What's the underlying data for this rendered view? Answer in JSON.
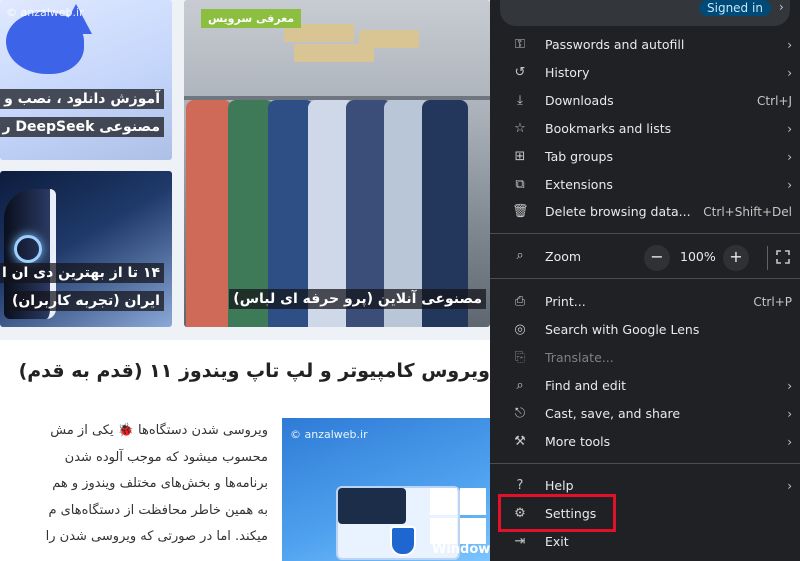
{
  "page": {
    "watermark": "© anzalweb.ir",
    "cards": [
      {
        "title_line1": "آموزش دانلود ، نصب و",
        "title_line2": "مصنوعی DeepSeek ر"
      },
      {
        "title_line1": "۱۴ تا از بهترین دی ان ا",
        "title_line2": "ایران (تجربه کاربران)"
      },
      {
        "tag": "معرفی سرویس",
        "title": "مصنوعی آنلاین (پرو حرفه ای لباس)"
      }
    ],
    "headline": "ویروس کامپیوتر و لپ تاپ ویندوز ۱۱ (قدم به قدم)",
    "paragraph_lines": [
      "ویروسی شدن دستگاه‌ها 🐞 یکی از مش",
      "محسوب میشود که موجب آلوده شدن",
      "برنامه‌ها و بخش‌های مختلف ویندوز و هم",
      "به همین خاطر محافظت از دستگاه‌های م",
      "میکند. اما در صورتی که ویروسی شدن را"
    ],
    "image_watermark": "© anzalweb.ir",
    "image_text": "Window"
  },
  "menu": {
    "signed_in": "Signed in",
    "items": [
      {
        "label": "Passwords and autofill",
        "icon": "key-icon",
        "glyph": "⚿",
        "right": "›"
      },
      {
        "label": "History",
        "icon": "history-icon",
        "glyph": "↺",
        "right": "›"
      },
      {
        "label": "Downloads",
        "icon": "download-icon",
        "glyph": "⤓",
        "right": "Ctrl+J"
      },
      {
        "label": "Bookmarks and lists",
        "icon": "star-icon",
        "glyph": "☆",
        "right": "›"
      },
      {
        "label": "Tab groups",
        "icon": "tab-groups-icon",
        "glyph": "⊞",
        "right": "›"
      },
      {
        "label": "Extensions",
        "icon": "extension-icon",
        "glyph": "⧉",
        "right": "›"
      },
      {
        "label": "Delete browsing data...",
        "icon": "trash-icon",
        "glyph": "🗑",
        "right": "Ctrl+Shift+Del"
      },
      {
        "label": "Print...",
        "icon": "print-icon",
        "glyph": "⎙",
        "right": "Ctrl+P"
      },
      {
        "label": "Search with Google Lens",
        "icon": "lens-icon",
        "glyph": "◎",
        "right": ""
      },
      {
        "label": "Translate...",
        "icon": "translate-icon",
        "glyph": "⎘",
        "right": ""
      },
      {
        "label": "Find and edit",
        "icon": "find-icon",
        "glyph": "⌕",
        "right": "›"
      },
      {
        "label": "Cast, save, and share",
        "icon": "share-icon",
        "glyph": "⎋",
        "right": "›"
      },
      {
        "label": "More tools",
        "icon": "toolbox-icon",
        "glyph": "⚒",
        "right": "›"
      },
      {
        "label": "Help",
        "icon": "help-icon",
        "glyph": "?",
        "right": "›"
      },
      {
        "label": "Settings",
        "icon": "gear-icon",
        "glyph": "⚙",
        "right": ""
      },
      {
        "label": "Exit",
        "icon": "exit-icon",
        "glyph": "⇥",
        "right": ""
      }
    ],
    "zoom": {
      "label": "Zoom",
      "value": "100%",
      "minus": "−",
      "plus": "+",
      "icon_glyph": "⌕"
    }
  }
}
